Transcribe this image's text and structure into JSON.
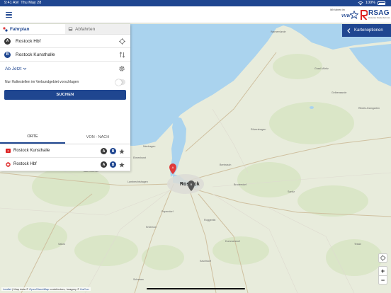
{
  "status": {
    "time": "9:41 AM",
    "date": "Thu May 28",
    "battery": "100%"
  },
  "header": {
    "vvw_tagline": "Wir fahren im",
    "vvw_name": "VVW",
    "rsag_name": "RSAG",
    "rsag_sub": "Rostocker Straßenbahn AG"
  },
  "panel": {
    "tabs": [
      {
        "label": "Fahrplan"
      },
      {
        "label": "Abfahrten"
      }
    ],
    "from": "Rostock Hbf",
    "to": "Rostock Kunsthalle",
    "time_label": "Ab Jetzt",
    "toggle_label": "Nur Haltestellen im Verbundgebiet vorschlagen",
    "search_label": "SUCHEN",
    "subtabs": [
      {
        "label": "ORTE"
      },
      {
        "label": "VON - NACH"
      }
    ]
  },
  "stations": [
    {
      "name": "Rostock Kunsthalle",
      "a": "A",
      "b": "B"
    },
    {
      "name": "Rostock Hbf",
      "a": "A",
      "b": "B"
    }
  ],
  "map": {
    "city_label": "Rostock",
    "marker_a": "A",
    "marker_b": "B",
    "places": [
      "Warnemünde",
      "Graal-Müritz",
      "Bad Doberan",
      "Kritzmow",
      "Sanitz",
      "Dummerstorf",
      "Rövershagen",
      "Gelbensande",
      "Broderstorf",
      "Bentwisch",
      "Papendorf",
      "Satow",
      "Tessin",
      "Schwaan",
      "Kavelstorf",
      "Roggentin",
      "Elmenhorst",
      "Lambrechtshagen",
      "Nienhagen",
      "Ribnitz-Damgarten"
    ],
    "options_label": "Kartenoptionen",
    "zoom_in": "+",
    "zoom_out": "−"
  },
  "attribution": {
    "leaflet": "Leaflet",
    "text": " | Map data © ",
    "osm": "OpenStreetMap",
    "text2": " contributors, Imagery © ",
    "here": "HaCon"
  },
  "colors": {
    "primary": "#1f4690",
    "water": "#a9d3f0",
    "land": "#e7ecdc",
    "marker": "#e03a3a"
  }
}
